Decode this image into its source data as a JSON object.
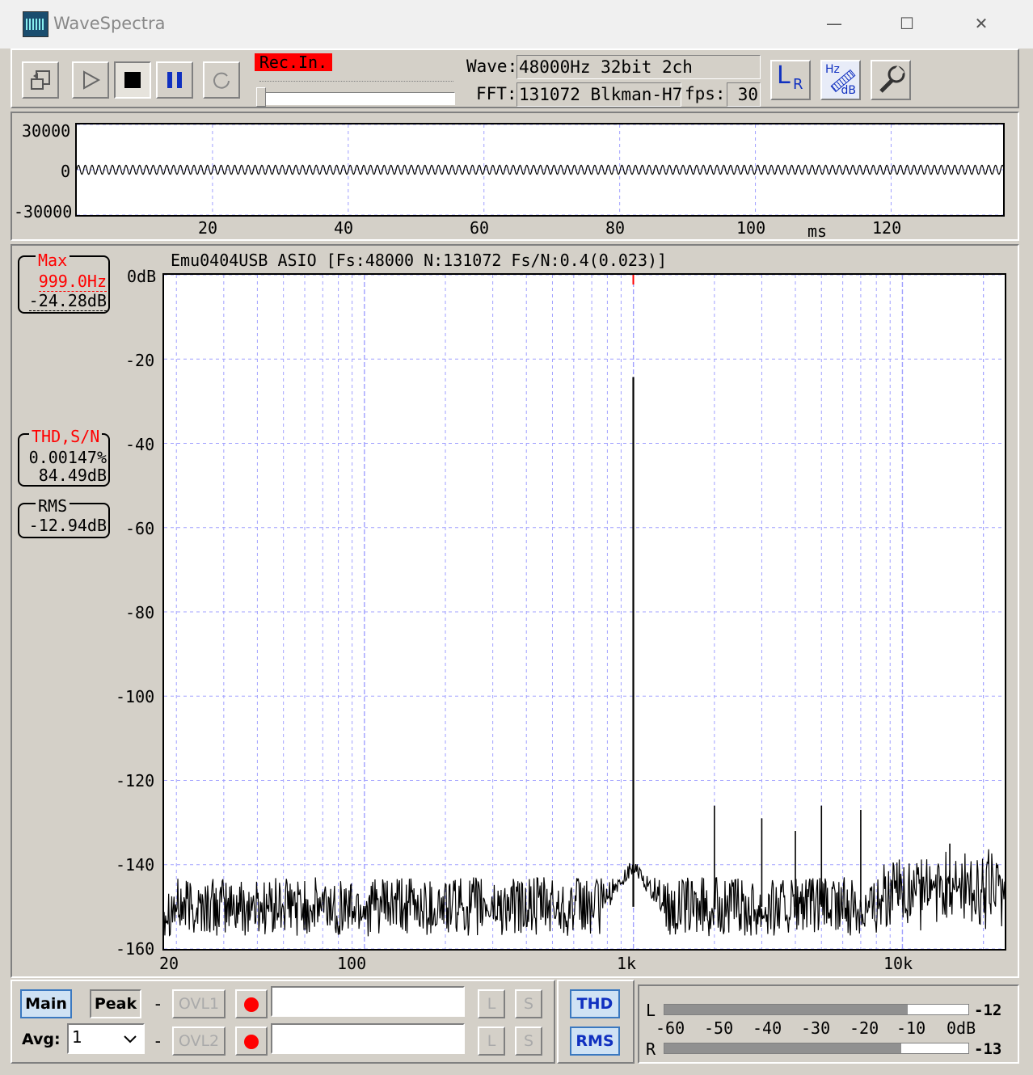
{
  "window": {
    "title": "WaveSpectra",
    "minimize": "—",
    "maximize": "☐",
    "close": "✕"
  },
  "toolbar": {
    "rec_label": "Rec.In.",
    "wave_label": "Wave:",
    "wave_value": "48000Hz 32bit 2ch",
    "fft_label": "FFT:",
    "fft_value": "131072 Blkman-H7",
    "fps_label": "fps:",
    "fps_value": "30",
    "lr_icon_text": "L",
    "lr_icon_sub": "R",
    "hzdb_top": "Hz",
    "hzdb_bottom": "dB"
  },
  "wave_plot": {
    "y_ticks": [
      "30000",
      "0",
      "-30000"
    ],
    "x_ticks": [
      "20",
      "40",
      "60",
      "80",
      "100",
      "120"
    ],
    "x_unit": "ms"
  },
  "spectrum": {
    "header": "Emu0404USB ASIO   [Fs:48000 N:131072 Fs/N:0.4(0.023)]",
    "y_ticks": [
      "0dB",
      "-20",
      "-40",
      "-60",
      "-80",
      "-100",
      "-120",
      "-140",
      "-160"
    ],
    "x_ticks": [
      "20",
      "100",
      "1k",
      "10k"
    ]
  },
  "readouts": {
    "max_title": "Max",
    "max_freq": "999.0Hz",
    "max_level": "-24.28dB",
    "thd_title": "THD,S/N",
    "thd_value": "0.00147%",
    "sn_value": "84.49dB",
    "rms_title": "RMS",
    "rms_value": "-12.94dB"
  },
  "bottom": {
    "main": "Main",
    "peak": "Peak",
    "avg_label": "Avg:",
    "avg_value": "1",
    "dash": "-",
    "ovl1": "OVL1",
    "ovl2": "OVL2",
    "l": "L",
    "s": "S",
    "thd": "THD",
    "rms": "RMS"
  },
  "meter": {
    "l_label": "L",
    "r_label": "R",
    "scale": [
      "-60",
      "-50",
      "-40",
      "-30",
      "-20",
      "-10",
      "0dB"
    ],
    "l_value": "-12",
    "r_value": "-13",
    "l_fill": 0.8,
    "r_fill": 0.78
  },
  "colors": {
    "accent_red": "#ff0000",
    "grid": "#a0a0ff",
    "button_blue": "#1030c0"
  },
  "chart_data": [
    {
      "type": "line",
      "title": "",
      "xlabel": "ms",
      "ylabel": "",
      "xlim": [
        0,
        136.5
      ],
      "ylim": [
        -30000,
        30000
      ],
      "series": [
        {
          "name": "",
          "x": [
            0,
            136.5
          ],
          "y_amplitude": 3000,
          "frequency_hz": 999
        }
      ]
    },
    {
      "type": "line",
      "title": "Emu0404USB ASIO   [Fs:48000 N:131072 Fs/N:0.4(0.023)]",
      "xlabel": "",
      "ylabel": "",
      "x_scale": "log",
      "xlim": [
        18,
        24000
      ],
      "ylim": [
        -160,
        0
      ],
      "peaks": [
        {
          "x": 999,
          "y": -24.28
        },
        {
          "x": 2000,
          "y": -126
        },
        {
          "x": 3000,
          "y": -129
        },
        {
          "x": 4000,
          "y": -132
        },
        {
          "x": 5000,
          "y": -126
        },
        {
          "x": 7000,
          "y": -127
        },
        {
          "x": 15000,
          "y": -135
        }
      ],
      "noise_floor": -150
    }
  ]
}
